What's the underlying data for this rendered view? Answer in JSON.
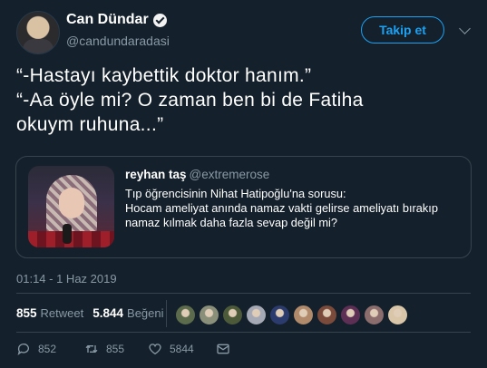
{
  "user": {
    "name": "Can Dündar",
    "handle": "@candundaradasi",
    "follow_label": "Takip et"
  },
  "tweet": {
    "text": "“-Hastayı kaybettik doktor hanım.”\n“-Aa öyle mi? O zaman ben bi de Fatiha\nokuym ruhuna...”"
  },
  "quoted": {
    "name": "reyhan taş",
    "handle": "@extremerose",
    "text": "Tıp öğrencisinin Nihat Hatipoğlu'na sorusu:\nHocam ameliyat anında namaz vakti gelirse ameliyatı bırakıp\nnamaz kılmak daha fazla sevap değil mi?"
  },
  "timestamp": "01:14 - 1 Haz 2019",
  "stats": {
    "retweet_count": "855",
    "retweet_label": "Retweet",
    "like_count": "5.844",
    "like_label": "Beğeni"
  },
  "liker_colors": [
    "#5b6b4c",
    "#8a8f7a",
    "#4d5a3a",
    "#a5a9b6",
    "#2c3b6e",
    "#b08a6a",
    "#7a4a3a",
    "#5e2f55",
    "#8c6d6d",
    "#d9c6a8"
  ],
  "actions": {
    "reply_count": "852",
    "retweet_count": "855",
    "like_count": "5844"
  },
  "colors": {
    "background": "#14202b",
    "accent": "#1da1f2",
    "muted": "#8899a6",
    "border": "#38444d"
  }
}
